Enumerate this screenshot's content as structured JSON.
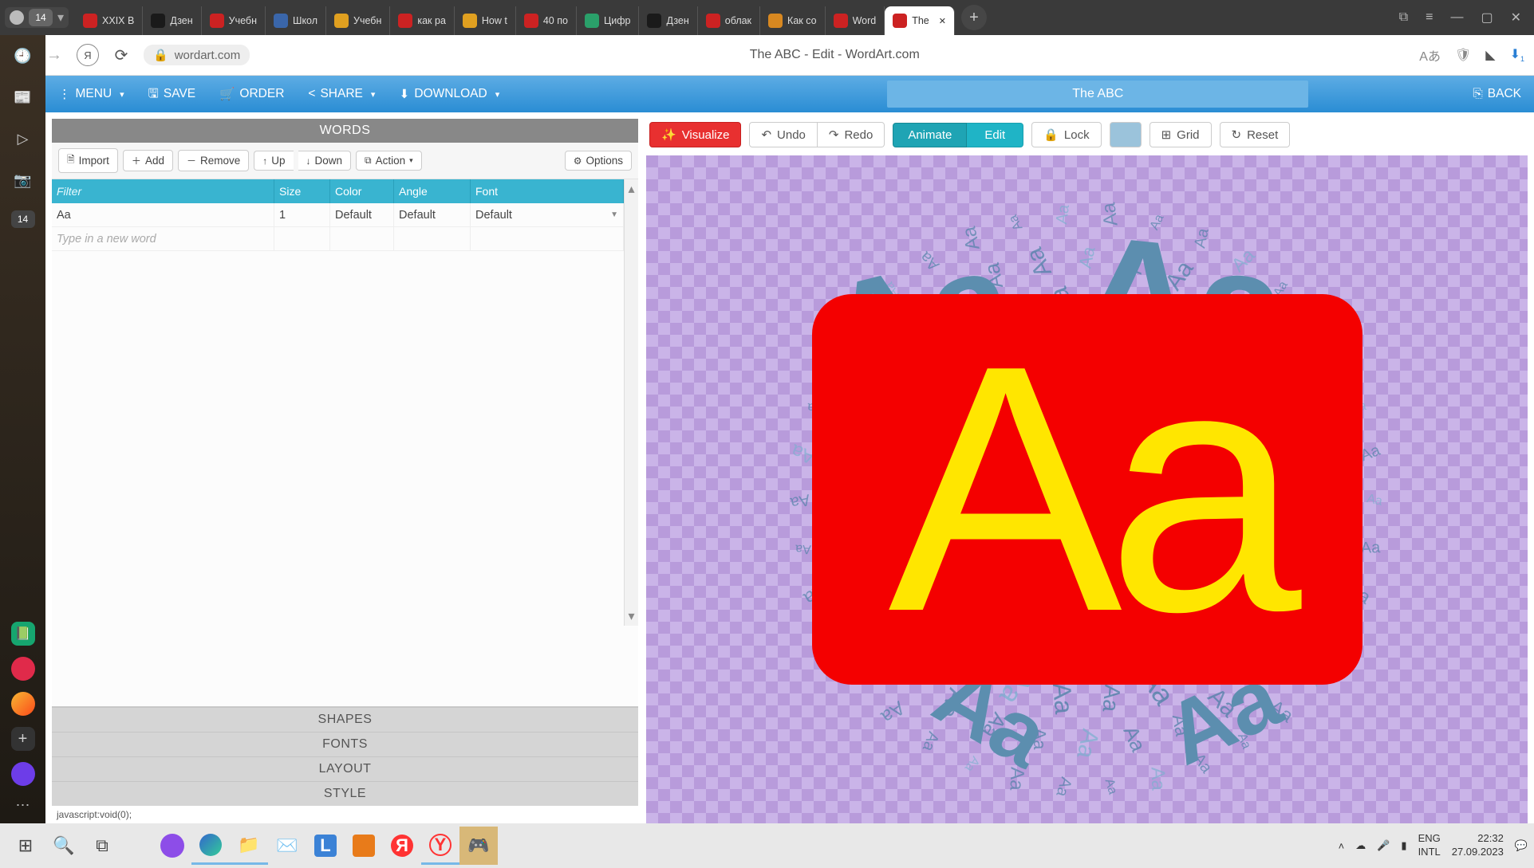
{
  "browser": {
    "profile_count": "14",
    "tabs": [
      {
        "label": "XXIX В",
        "color": "#cc2222"
      },
      {
        "label": "Дзен",
        "color": "#1a1a1a"
      },
      {
        "label": "Учебн",
        "color": "#cc2222"
      },
      {
        "label": "Школ",
        "color": "#3a66aa"
      },
      {
        "label": "Учебн",
        "color": "#e0a020"
      },
      {
        "label": "как ра",
        "color": "#cc2222"
      },
      {
        "label": "How t",
        "color": "#e0a020"
      },
      {
        "label": "40 по",
        "color": "#cc2222"
      },
      {
        "label": "Цифр",
        "color": "#2aa06a"
      },
      {
        "label": "Дзен",
        "color": "#1a1a1a"
      },
      {
        "label": "облак",
        "color": "#cc2222"
      },
      {
        "label": "Как со",
        "color": "#d88820"
      },
      {
        "label": "Word",
        "color": "#c22"
      },
      {
        "label": "The",
        "color": "#c22",
        "active": true
      }
    ],
    "address": "wordart.com",
    "page_title": "The ABC - Edit - WordArt.com"
  },
  "app_toolbar": {
    "menu": "MENU",
    "save": "SAVE",
    "order": "ORDER",
    "share": "SHARE",
    "download": "DOWNLOAD",
    "art_name": "The ABC",
    "back": "BACK"
  },
  "left_panel": {
    "sections": {
      "words": "WORDS",
      "shapes": "SHAPES",
      "fonts": "FONTS",
      "layout": "LAYOUT",
      "style": "STYLE"
    },
    "words_toolbar": {
      "import": "Import",
      "add": "Add",
      "remove": "Remove",
      "up": "Up",
      "down": "Down",
      "action": "Action",
      "options": "Options"
    },
    "table": {
      "filter_placeholder": "Filter",
      "headers": {
        "size": "Size",
        "color": "Color",
        "angle": "Angle",
        "font": "Font"
      },
      "rows": [
        {
          "word": "Aa",
          "size": "1",
          "color": "Default",
          "angle": "Default",
          "font": "Default"
        }
      ],
      "new_placeholder": "Type in a new word"
    },
    "status": "javascript:void(0);"
  },
  "canvas_toolbar": {
    "visualize": "Visualize",
    "undo": "Undo",
    "redo": "Redo",
    "animate": "Animate",
    "edit": "Edit",
    "lock": "Lock",
    "grid": "Grid",
    "reset": "Reset",
    "swatch": "#9bc3db"
  },
  "canvas": {
    "main_text": "Aa",
    "cloud_word": "Aa"
  },
  "taskbar": {
    "lang1": "ENG",
    "lang2": "INTL",
    "time": "22:32",
    "date": "27.09.2023"
  }
}
